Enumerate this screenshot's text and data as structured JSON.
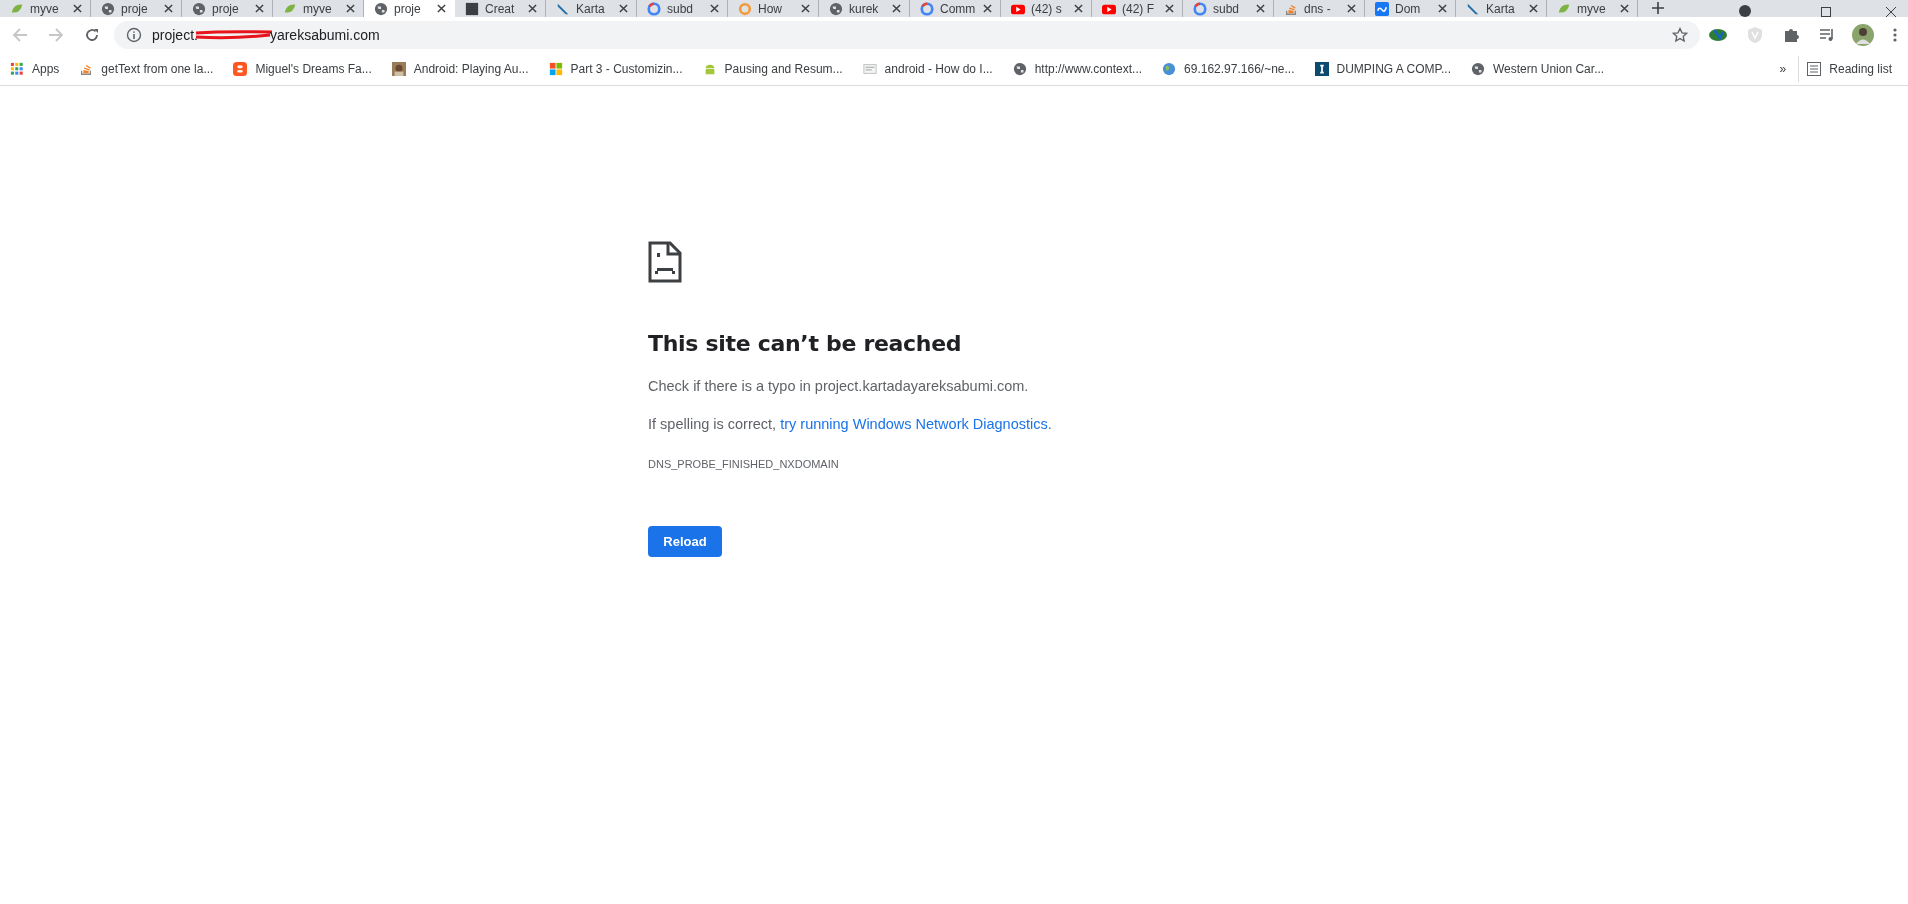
{
  "tabs": [
    {
      "label": "myve",
      "kind": "leaf",
      "selected": false
    },
    {
      "label": "proje",
      "kind": "globe",
      "selected": false
    },
    {
      "label": "proje",
      "kind": "globe",
      "selected": false
    },
    {
      "label": "myve",
      "kind": "leaf",
      "selected": false
    },
    {
      "label": "proje",
      "kind": "globe",
      "selected": true
    },
    {
      "label": "Creat",
      "kind": "square",
      "selected": false
    },
    {
      "label": "Karta",
      "kind": "feather",
      "selected": false
    },
    {
      "label": "subd",
      "kind": "google",
      "selected": false
    },
    {
      "label": "How",
      "kind": "ring",
      "selected": false
    },
    {
      "label": "kurek",
      "kind": "globe",
      "selected": false
    },
    {
      "label": "Comm",
      "kind": "google",
      "selected": false
    },
    {
      "label": "(42) s",
      "kind": "video",
      "selected": false
    },
    {
      "label": "(42) F",
      "kind": "video",
      "selected": false
    },
    {
      "label": "subd",
      "kind": "google",
      "selected": false
    },
    {
      "label": "dns -",
      "kind": "stack",
      "selected": false
    },
    {
      "label": "Dom",
      "kind": "wave",
      "selected": false
    },
    {
      "label": "Karta",
      "kind": "feather",
      "selected": false
    },
    {
      "label": "myve",
      "kind": "leaf",
      "selected": false
    }
  ],
  "address": {
    "prefix": "project.",
    "suffix": "yareksabumi.com"
  },
  "bookmarks": [
    {
      "label": "Apps",
      "kind": "grid"
    },
    {
      "label": "getText from one la...",
      "kind": "stack"
    },
    {
      "label": "Miguel's Dreams Fa...",
      "kind": "blog"
    },
    {
      "label": "Android: Playing Au..."
    },
    {
      "label": "Part 3 - Customizin...",
      "kind": "windows"
    },
    {
      "label": "Pausing and Resum...",
      "kind": "android"
    },
    {
      "label": "android - How do I...",
      "kind": "doc"
    },
    {
      "label": "http://www.context...",
      "kind": "globe"
    },
    {
      "label": "69.162.97.166/~ne...",
      "kind": "earth"
    },
    {
      "label": "DUMPING A COMP...",
      "kind": "letter"
    },
    {
      "label": "Western Union Car...",
      "kind": "globe"
    }
  ],
  "more_bookmarks": "»",
  "reading_list": "Reading list",
  "error": {
    "title": "This site can’t be reached",
    "line1": "Check if there is a typo in project.kartadayareksabumi.com.",
    "line2_prefix": "If spelling is correct, ",
    "line2_link": "try running Windows Network Diagnostics",
    "line2_suffix": ".",
    "code": "DNS_PROBE_FINISHED_NXDOMAIN",
    "button": "Reload"
  }
}
